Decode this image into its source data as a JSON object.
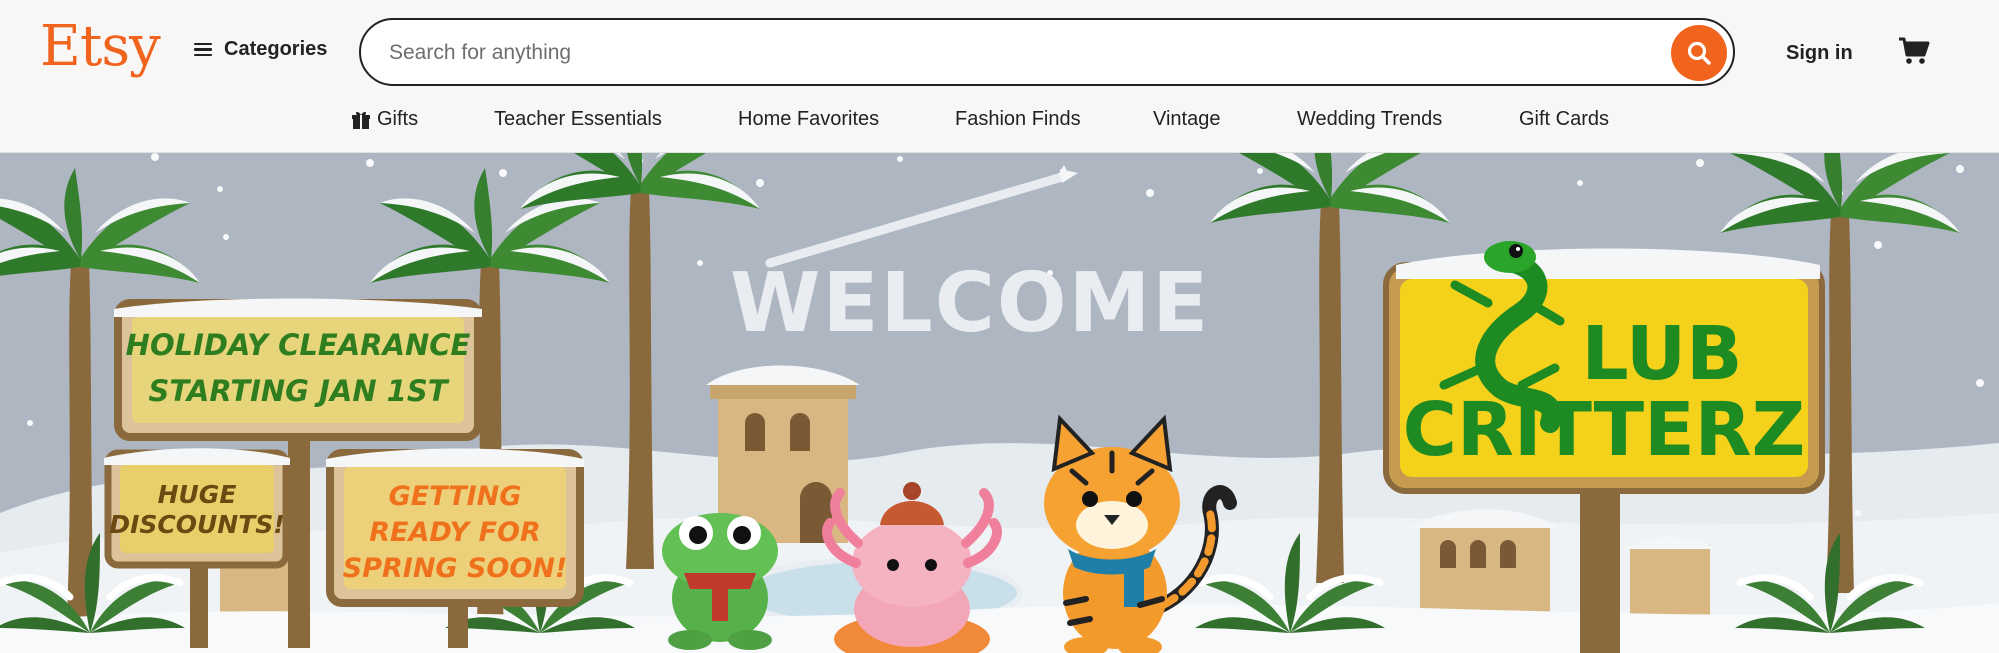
{
  "brand": {
    "logo_text": "Etsy",
    "accent": "#f1641e"
  },
  "header": {
    "categories_label": "Categories",
    "search": {
      "placeholder": "Search for anything",
      "value": ""
    },
    "signin_label": "Sign in",
    "cart_icon": "cart-icon"
  },
  "nav": {
    "items": [
      {
        "label": "Gifts",
        "icon": "gift-icon"
      },
      {
        "label": "Teacher Essentials"
      },
      {
        "label": "Home Favorites"
      },
      {
        "label": "Fashion Finds"
      },
      {
        "label": "Vintage"
      },
      {
        "label": "Wedding Trends"
      },
      {
        "label": "Gift Cards"
      }
    ]
  },
  "hero": {
    "sky_text": "WELCOME",
    "sign_holiday": {
      "line1": "HOLIDAY CLEARANCE",
      "line2": "STARTING JAN 1ST"
    },
    "sign_discounts": {
      "line1": "HUGE",
      "line2": "DISCOUNTS!"
    },
    "sign_spring": {
      "line1": "GETTING",
      "line2": "READY FOR",
      "line3": "SPRING SOON!"
    },
    "sign_club": {
      "line1": "LUB",
      "line2": "CRITTERZ"
    }
  }
}
